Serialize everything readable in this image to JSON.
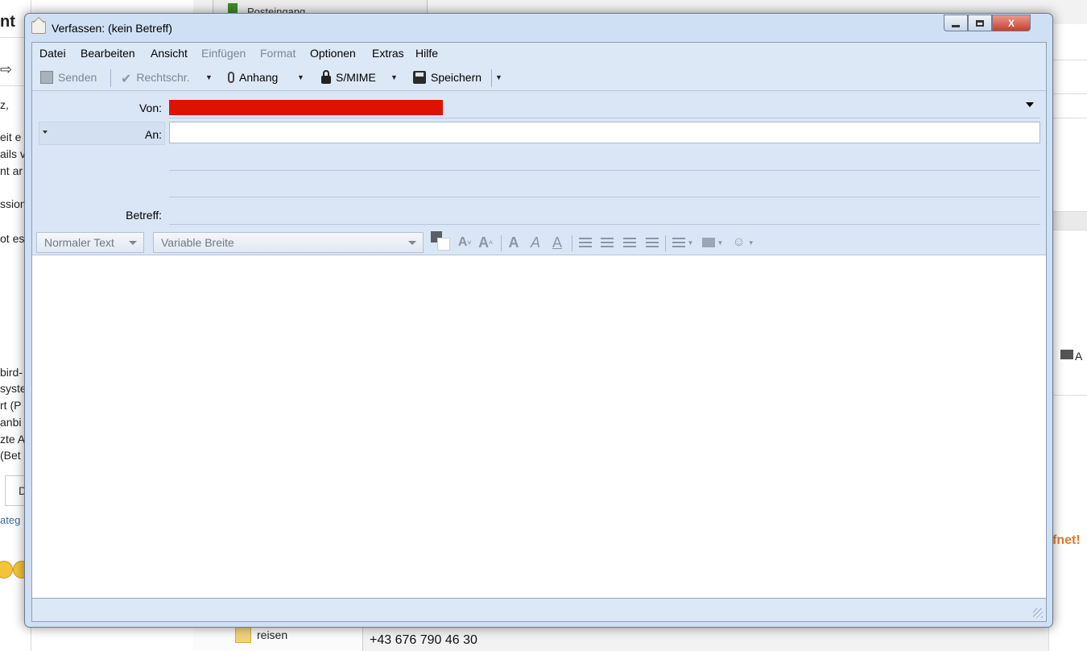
{
  "background": {
    "left_fragments": {
      "heading": "nt",
      "comma": "z,",
      "line1": "eit e",
      "line2": "ails v",
      "line3": "nt ar",
      "line4": "ssion",
      "line5": "ot es",
      "line6": "bird-",
      "line7": "syste",
      "line8": "rt (P",
      "line9": "anbi",
      "line10": "zte A",
      "line11": "(Bet",
      "button": "D",
      "link": "ateg"
    },
    "tab_label": "Posteingang",
    "folder_label": "reisen",
    "phone": "+43 676 790 46 30",
    "right_fragment_a": "A",
    "right_fragment_orange": "fnet!"
  },
  "window": {
    "title": "Verfassen: (kein Betreff)",
    "close_symbol": "X"
  },
  "menu": [
    {
      "label": "Datei",
      "enabled": true
    },
    {
      "label": "Bearbeiten",
      "enabled": true
    },
    {
      "label": "Ansicht",
      "enabled": true
    },
    {
      "label": "Einfügen",
      "enabled": false
    },
    {
      "label": "Format",
      "enabled": false
    },
    {
      "label": "Optionen",
      "enabled": true
    },
    {
      "label": "Extras",
      "enabled": true
    },
    {
      "label": "Hilfe",
      "enabled": true
    }
  ],
  "toolbar": {
    "send": "Senden",
    "spell": "Rechtschr.",
    "attach": "Anhang",
    "smime": "S/MIME",
    "save": "Speichern"
  },
  "headers": {
    "from_label": "Von:",
    "to_label": "An:",
    "subject_label": "Betreff:",
    "to_value": "",
    "subject_value": ""
  },
  "format": {
    "paragraph": "Normaler Text",
    "font": "Variable Breite"
  },
  "colors": {
    "redacted": "#dd1200",
    "window_chrome": "#cfe0f5",
    "accent_orange": "#e07a2a"
  }
}
